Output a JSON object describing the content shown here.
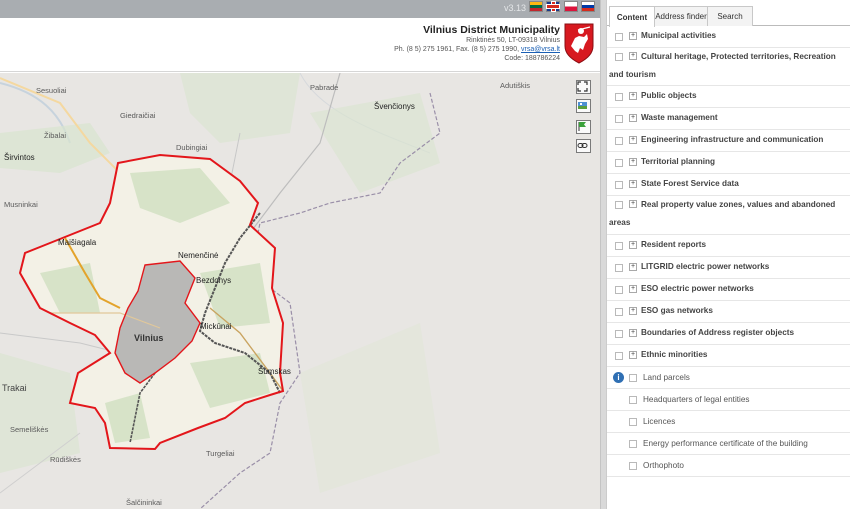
{
  "topbar": {
    "version": "v3.13"
  },
  "header": {
    "title": "Vilnius District Municipality",
    "address": "Rinktinės 50, LT-09318 Vilnius",
    "contacts_prefix": "Ph. (8 5) 275 1961, Fax. (8 5) 275 1990,",
    "email": "vrsa@vrsa.lt",
    "code": "Code: 188786224"
  },
  "map": {
    "places": {
      "sesuoliai": "Sesuoliai",
      "zibalai": "Žibalai",
      "sirvintos": "Širvintos",
      "musninkai": "Musninkai",
      "dubingiai": "Dubingiai",
      "giedraiciai": "Giedraičiai",
      "svencionys": "Švenčionys",
      "maisiagala": "Maišiagala",
      "nemencine": "Nemenčinė",
      "bezdonys": "Bezdonys",
      "trakai": "Trakai",
      "vilnius": "Vilnius",
      "mickunai": "Mickūnai",
      "sumskas": "Šumskas",
      "rudiskes": "Rūdiškės",
      "salcininkai": "Šalčininkai",
      "turgeliai": "Turgeliai",
      "adutiskis": "Adutiškis",
      "semeliskes": "Semeliškės",
      "pabrade": "Pabradė"
    }
  },
  "tabs": [
    {
      "label": "Content"
    },
    {
      "label": "Address finder"
    },
    {
      "label": "Search"
    }
  ],
  "layers": [
    {
      "label": "Municipal activities"
    },
    {
      "label": "Cultural heritage, Protected territories, Recreation and tourism"
    },
    {
      "label": "Public objects"
    },
    {
      "label": "Waste management"
    },
    {
      "label": "Engineering infrastructure and communication"
    },
    {
      "label": "Territorial planning"
    },
    {
      "label": "State Forest Service data"
    },
    {
      "label": "Real property value zones, values and abandoned areas"
    },
    {
      "label": "Resident reports"
    },
    {
      "label": "LITGRID electric power networks"
    },
    {
      "label": "ESO electric power networks"
    },
    {
      "label": "ESO gas networks"
    },
    {
      "label": "Boundaries of Address register objects"
    },
    {
      "label": "Ethnic minorities"
    }
  ],
  "sublayers": [
    {
      "label": "Land parcels"
    },
    {
      "label": "Headquarters of legal entities"
    },
    {
      "label": "Licences"
    },
    {
      "label": "Energy performance certificate of the building"
    },
    {
      "label": "Orthophoto"
    }
  ],
  "colors": {
    "boundary": "#e3161b",
    "topbar": "#a9adb1",
    "link": "#1a5fb4"
  },
  "icons": [
    "fullscreen-icon",
    "layers-icon",
    "flag-icon",
    "link-icon",
    "info-icon"
  ]
}
